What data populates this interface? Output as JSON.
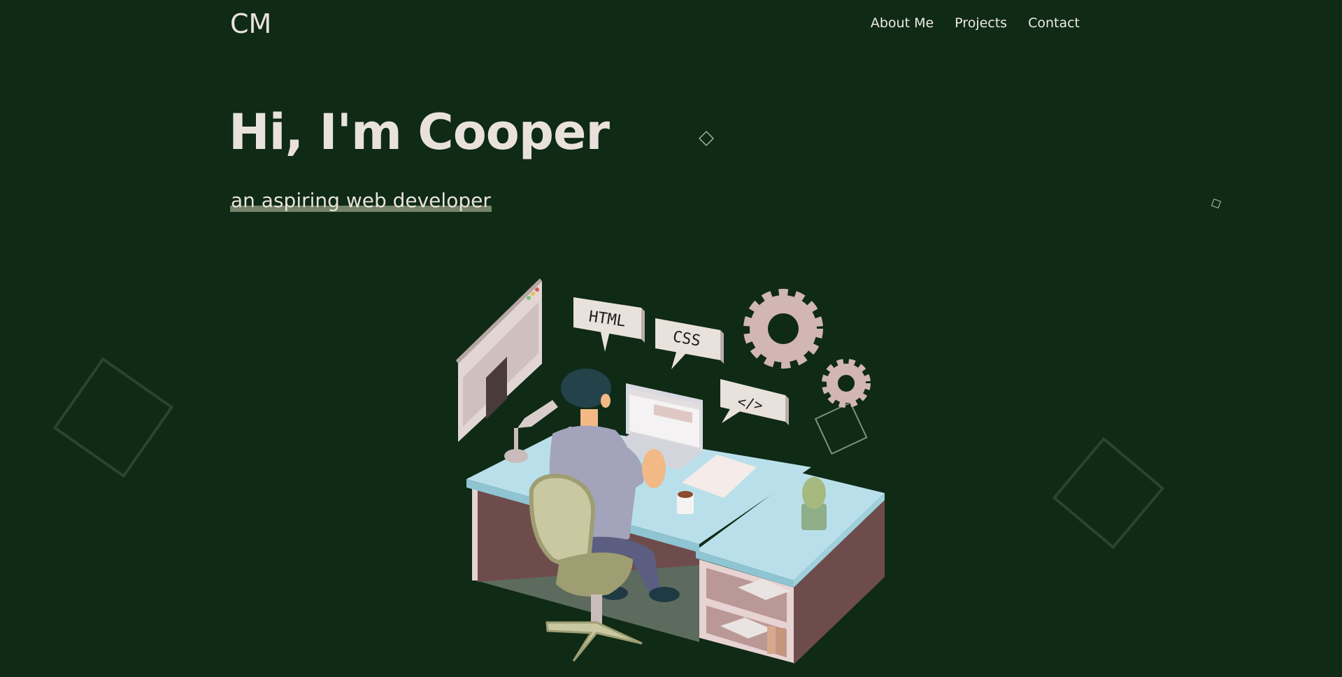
{
  "header": {
    "logo": "CM",
    "nav": [
      {
        "label": "About Me"
      },
      {
        "label": "Projects"
      },
      {
        "label": "Contact"
      }
    ]
  },
  "hero": {
    "title": "Hi, I'm Cooper",
    "subtitle": "an aspiring web developer"
  },
  "illustration": {
    "bubbles": [
      "HTML",
      "CSS",
      "</>"
    ]
  },
  "colors": {
    "background": "#0f2a15",
    "text": "#e9e2dc",
    "accent_underline": "#74836a",
    "desk_top": "#b9e0ea",
    "desk_side": "#6e4c4c",
    "gear": "#d1b6b3",
    "chair": "#c9c8a0",
    "shirt": "#a3a3bc"
  }
}
